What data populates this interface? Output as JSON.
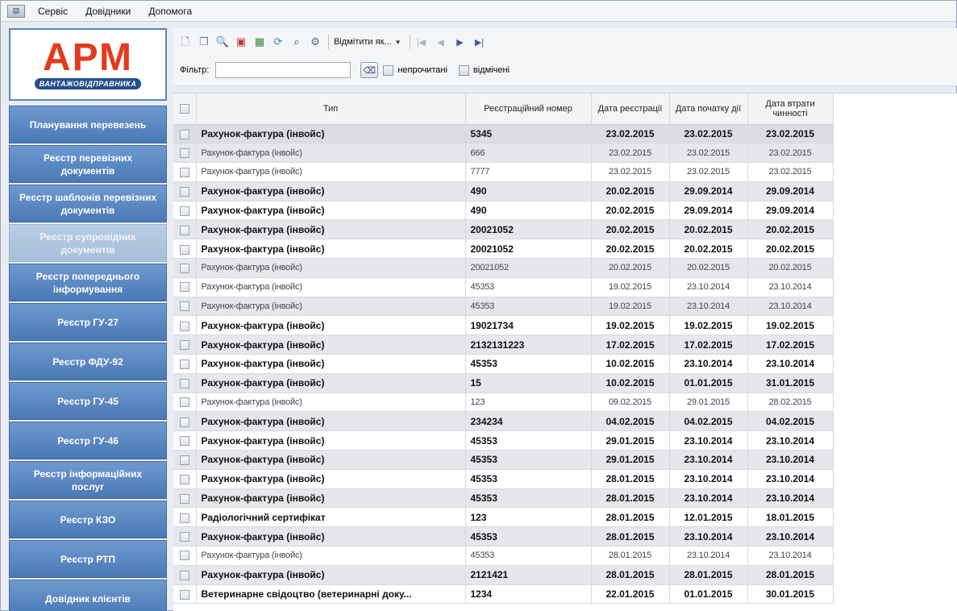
{
  "menu": {
    "items": [
      "Сервіс",
      "Довідники",
      "Допомога"
    ]
  },
  "logo": {
    "main": "АРМ",
    "sub": "ВАНТАЖОВІДПРАВНИКА"
  },
  "sidebar": {
    "items": [
      {
        "label": "Планування перевезень",
        "active": false
      },
      {
        "label": "Реєстр перевізних документів",
        "active": false
      },
      {
        "label": "Реєстр шаблонів перевізних документів",
        "active": false
      },
      {
        "label": "Реєстр супровідних документів",
        "active": true
      },
      {
        "label": "Реєстр попереднього інформування",
        "active": false
      },
      {
        "label": "Реєстр ГУ-27",
        "active": false
      },
      {
        "label": "Реєстр ФДУ-92",
        "active": false
      },
      {
        "label": "Реєстр ГУ-45",
        "active": false
      },
      {
        "label": "Реєстр ГУ-46",
        "active": false
      },
      {
        "label": "Реєстр інформаційних послуг",
        "active": false
      },
      {
        "label": "Реєстр КЗО",
        "active": false
      },
      {
        "label": "Реєстр РТП",
        "active": false
      },
      {
        "label": "Довідник клієнтів",
        "active": false
      }
    ]
  },
  "toolbar": {
    "mark_dropdown_label": "Відмітити як...",
    "filter_label": "Фільтр:",
    "filter_value": "",
    "unread_label": "непрочитані",
    "marked_label": "відмічені"
  },
  "grid": {
    "columns": [
      "Тип",
      "Реєстраційний номер",
      "Дата реєстрації",
      "Дата початку дії",
      "Дата втрати чинності"
    ],
    "rows": [
      {
        "bold": true,
        "type": "Рахунок-фактура (інвойс)",
        "number": "5345",
        "reg": "23.02.2015",
        "start": "23.02.2015",
        "end": "23.02.2015"
      },
      {
        "bold": false,
        "type": "Рахунок-фактура (інвойс)",
        "number": "666",
        "reg": "23.02.2015",
        "start": "23.02.2015",
        "end": "23.02.2015"
      },
      {
        "bold": false,
        "type": "Рахунок-фактура (інвойс)",
        "number": "7777",
        "reg": "23.02.2015",
        "start": "23.02.2015",
        "end": "23.02.2015"
      },
      {
        "bold": true,
        "type": "Рахунок-фактура (інвойс)",
        "number": "490",
        "reg": "20.02.2015",
        "start": "29.09.2014",
        "end": "29.09.2014"
      },
      {
        "bold": true,
        "type": "Рахунок-фактура (інвойс)",
        "number": "490",
        "reg": "20.02.2015",
        "start": "29.09.2014",
        "end": "29.09.2014"
      },
      {
        "bold": true,
        "type": "Рахунок-фактура (інвойс)",
        "number": "20021052",
        "reg": "20.02.2015",
        "start": "20.02.2015",
        "end": "20.02.2015"
      },
      {
        "bold": true,
        "type": "Рахунок-фактура (інвойс)",
        "number": "20021052",
        "reg": "20.02.2015",
        "start": "20.02.2015",
        "end": "20.02.2015"
      },
      {
        "bold": false,
        "type": "Рахунок-фактура (інвойс)",
        "number": "20021052",
        "reg": "20.02.2015",
        "start": "20.02.2015",
        "end": "20.02.2015"
      },
      {
        "bold": false,
        "type": "Рахунок-фактура (інвойс)",
        "number": "45353",
        "reg": "19.02.2015",
        "start": "23.10.2014",
        "end": "23.10.2014"
      },
      {
        "bold": false,
        "type": "Рахунок-фактура (інвойс)",
        "number": "45353",
        "reg": "19.02.2015",
        "start": "23.10.2014",
        "end": "23.10.2014"
      },
      {
        "bold": true,
        "type": "Рахунок-фактура (інвойс)",
        "number": "19021734",
        "reg": "19.02.2015",
        "start": "19.02.2015",
        "end": "19.02.2015"
      },
      {
        "bold": true,
        "type": "Рахунок-фактура (інвойс)",
        "number": "2132131223",
        "reg": "17.02.2015",
        "start": "17.02.2015",
        "end": "17.02.2015"
      },
      {
        "bold": true,
        "type": "Рахунок-фактура (інвойс)",
        "number": "45353",
        "reg": "10.02.2015",
        "start": "23.10.2014",
        "end": "23.10.2014"
      },
      {
        "bold": true,
        "type": "Рахунок-фактура (інвойс)",
        "number": "15",
        "reg": "10.02.2015",
        "start": "01.01.2015",
        "end": "31.01.2015"
      },
      {
        "bold": false,
        "type": "Рахунок-фактура (інвойс)",
        "number": "123",
        "reg": "09.02.2015",
        "start": "29.01.2015",
        "end": "28.02.2015"
      },
      {
        "bold": true,
        "type": "Рахунок-фактура (інвойс)",
        "number": "234234",
        "reg": "04.02.2015",
        "start": "04.02.2015",
        "end": "04.02.2015"
      },
      {
        "bold": true,
        "type": "Рахунок-фактура (інвойс)",
        "number": "45353",
        "reg": "29.01.2015",
        "start": "23.10.2014",
        "end": "23.10.2014"
      },
      {
        "bold": true,
        "type": "Рахунок-фактура (інвойс)",
        "number": "45353",
        "reg": "29.01.2015",
        "start": "23.10.2014",
        "end": "23.10.2014"
      },
      {
        "bold": true,
        "type": "Рахунок-фактура (інвойс)",
        "number": "45353",
        "reg": "28.01.2015",
        "start": "23.10.2014",
        "end": "23.10.2014"
      },
      {
        "bold": true,
        "type": "Рахунок-фактура (інвойс)",
        "number": "45353",
        "reg": "28.01.2015",
        "start": "23.10.2014",
        "end": "23.10.2014"
      },
      {
        "bold": true,
        "type": "Радіологічний сертифікат",
        "number": "123",
        "reg": "28.01.2015",
        "start": "12.01.2015",
        "end": "18.01.2015"
      },
      {
        "bold": true,
        "type": "Рахунок-фактура (інвойс)",
        "number": "45353",
        "reg": "28.01.2015",
        "start": "23.10.2014",
        "end": "23.10.2014"
      },
      {
        "bold": false,
        "type": "Рахунок-фактура (інвойс)",
        "number": "45353",
        "reg": "28.01.2015",
        "start": "23.10.2014",
        "end": "23.10.2014"
      },
      {
        "bold": true,
        "type": "Рахунок-фактура (інвойс)",
        "number": "2121421",
        "reg": "28.01.2015",
        "start": "28.01.2015",
        "end": "28.01.2015"
      },
      {
        "bold": true,
        "type": "Ветеринарне свідоцтво (ветеринарні доку...",
        "number": "1234",
        "reg": "22.01.2015",
        "start": "01.01.2015",
        "end": "30.01.2015"
      }
    ]
  }
}
